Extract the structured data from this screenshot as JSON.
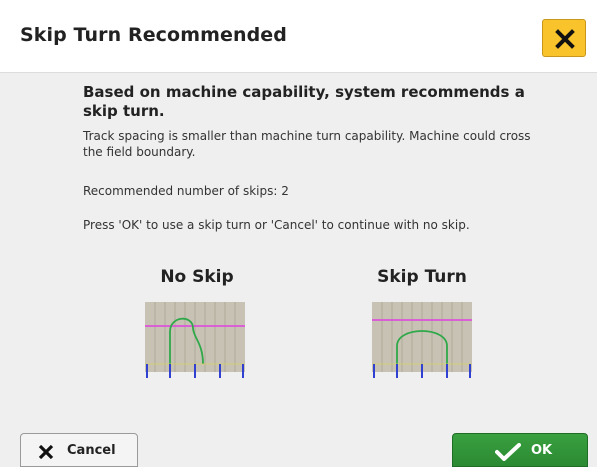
{
  "dialog": {
    "title": "Skip Turn Recommended",
    "close_icon": "close-icon"
  },
  "body": {
    "heading": "Based on machine capability, system recommends a skip turn.",
    "explanation": "Track spacing is smaller than machine turn capability. Machine could cross the field boundary.",
    "recommended_skips": "Recommended number of skips: 2",
    "instructions": "Press 'OK' to use a skip turn or 'Cancel' to continue with no skip."
  },
  "options": {
    "no_skip_label": "No Skip",
    "skip_turn_label": "Skip Turn"
  },
  "footer": {
    "cancel_label": "Cancel",
    "cancel_icon": "x-icon",
    "ok_label": "OK",
    "ok_icon": "checkmark-icon"
  },
  "colors": {
    "accent_yellow": "#f9c32c",
    "ok_green": "#2f9436",
    "boundary_magenta": "#e040e0",
    "path_green": "#2fa84a",
    "track_blue": "#3040d0",
    "diagram_bg": "#c8c2b4"
  }
}
